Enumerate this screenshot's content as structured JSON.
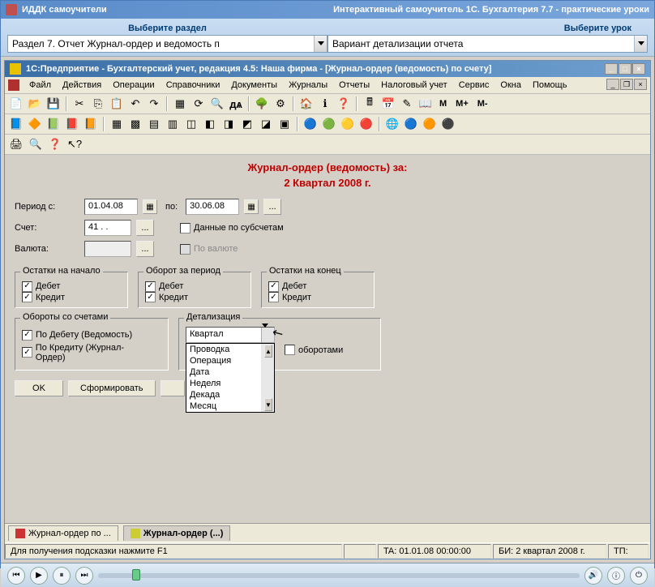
{
  "outer": {
    "app_title": "ИДДК самоучители",
    "tutorial_title": "Интерактивный самоучитель 1С. Бухгалтерия 7.7 - практические уроки",
    "header_left": "Выберите раздел",
    "header_right": "Выберите урок",
    "combo_section": "Раздел 7. Отчет Журнал-ордер и ведомость п",
    "combo_lesson": "Вариант детализации отчета"
  },
  "inner": {
    "title": "1С:Предприятие - Бухгалтерский учет, редакция 4.5: Наша фирма - [Журнал-ордер (ведомость) по счету]"
  },
  "menu": [
    "Файл",
    "Действия",
    "Операции",
    "Справочники",
    "Документы",
    "Журналы",
    "Отчеты",
    "Налоговый учет",
    "Сервис",
    "Окна",
    "Помощь"
  ],
  "doc": {
    "title": "Журнал-ордер (ведомость) за:",
    "subtitle": "2 Квартал 2008 г.",
    "period_label": "Период с:",
    "date_from": "01.04.08",
    "to_label": "по:",
    "date_to": "30.06.08",
    "account_label": "Счет:",
    "account_value": "41 . .",
    "sub_accounts": "Данные по субсчетам",
    "currency_label": "Валюта:",
    "currency_cb": "По валюте",
    "group_start": "Остатки на начало",
    "group_period": "Оборот за период",
    "group_end": "Остатки на конец",
    "debit": "Дебет",
    "credit": "Кредит",
    "group_turnover": "Обороты со счетами",
    "cb_debit_ved": "По Дебету (Ведомость)",
    "cb_credit_jo": "По Кредиту (Журнал-Ордер)",
    "group_detail": "Детализация",
    "detail_selected": "Квартал",
    "detail_options": [
      "Проводка",
      "Операция",
      "Дата",
      "Неделя",
      "Декада",
      "Месяц"
    ],
    "with_turnover": "оборотами",
    "btn_ok": "OK",
    "btn_form": "Сформировать"
  },
  "tabs": {
    "t1": "Журнал-ордер по ...",
    "t2": "Журнал-ордер (...)"
  },
  "status": {
    "hint": "Для получения подсказки нажмите F1",
    "ta": "TA: 01.01.08  00:00:00",
    "bi": "БИ: 2 квартал 2008 г.",
    "tp": "ТП:"
  },
  "toolbar_text": {
    "m": "М",
    "mp": "М+",
    "mm": "М-"
  },
  "slider": {
    "pos_percent": 7
  }
}
